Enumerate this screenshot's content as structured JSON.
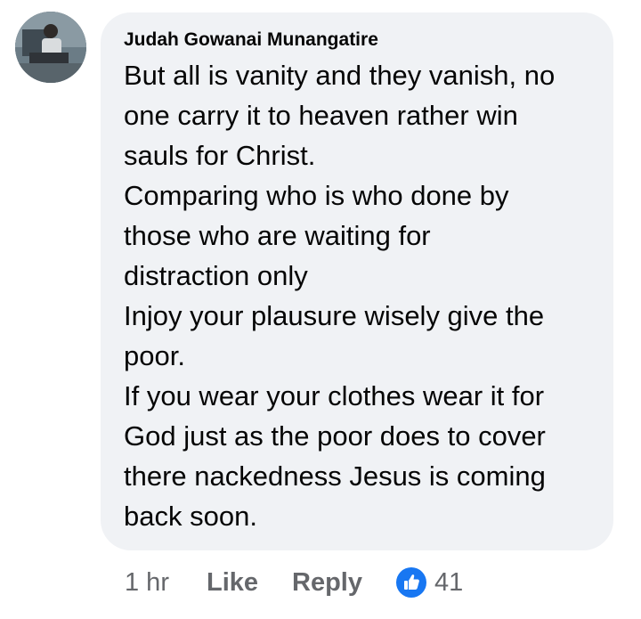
{
  "comment": {
    "author": "Judah Gowanai Munangatire",
    "lines": [
      "But all is vanity and they vanish, no",
      "one carry it to heaven rather win",
      "sauls for Christ.",
      "Comparing who is who done by",
      "those who are waiting for",
      "distraction only",
      "Injoy your plausure wisely give the",
      "poor.",
      "If you wear your clothes wear it for",
      "God just as the poor does to cover",
      "there nackedness Jesus is coming",
      "back soon."
    ]
  },
  "actions": {
    "time": "1 hr",
    "like_label": "Like",
    "reply_label": "Reply",
    "reaction_icon": "like-icon",
    "reaction_count": "41"
  },
  "colors": {
    "bubble": "#f0f2f5",
    "text": "#050505",
    "secondary": "#65676b",
    "like_blue": "#1877f2"
  }
}
